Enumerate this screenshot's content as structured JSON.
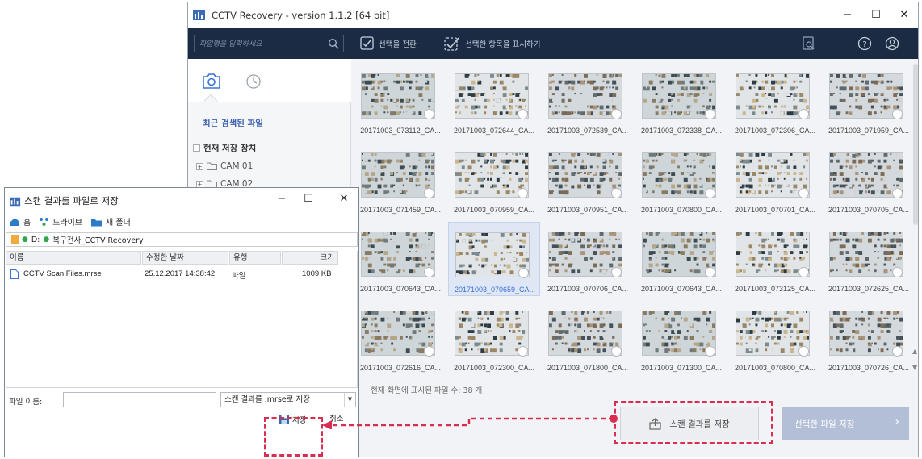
{
  "main_window": {
    "title": "CCTV Recovery - version 1.1.2 [64 bit]",
    "controls": {
      "minimize": "−",
      "maximize": "☐",
      "close": "✕"
    }
  },
  "toolbar": {
    "search_placeholder": "파일명을 입력하세요",
    "toggle_selection_label": "선택을 전환",
    "show_selected_label": "선택한 항목을 표시하기"
  },
  "sidebar": {
    "recent_label": "최근 검색된 파일",
    "current_device_label": "현재 저장 장치",
    "tree_items": [
      "CAM 01",
      "CAM 02"
    ]
  },
  "thumbnails": [
    "20171003_073112_CA...",
    "20171003_072644_CA...",
    "20171003_072539_CA...",
    "20171003_072338_CA...",
    "20171003_072306_CA...",
    "20171003_071959_CA...",
    "20171003_071459_CA...",
    "20171003_070959_CA...",
    "20171003_070951_CA...",
    "20171003_070800_CA...",
    "20171003_070701_CA...",
    "20171003_070705_CA...",
    "20171003_070643_CA...",
    "20171003_070659_CA...",
    "20171003_070706_CA...",
    "20171003_070643_CA...",
    "20171003_073125_CA...",
    "20171003_072625_CA...",
    "20171003_072616_CA...",
    "20171003_072300_CA...",
    "20171003_071800_CA...",
    "20171003_071300_CA...",
    "20171003_070800_CA...",
    "20171003_070726_CA..."
  ],
  "selected_thumbnail_label": "20171003_070659_CA...",
  "status": "현재 화면에 표시된 파일 수: 38 개",
  "bottom_buttons": {
    "save_scan": "스캔 결과를 저장",
    "save_selected": "선택한 파일 저장"
  },
  "dialog": {
    "title": "스캔 결과를 파일로 저장",
    "controls": {
      "minimize": "−",
      "maximize": "☐",
      "close": "✕"
    },
    "nav": {
      "home": "홈",
      "drive": "드라이브",
      "new_folder": "새 폴더"
    },
    "path": {
      "drive": "D:",
      "folder": "복구전사_CCTV Recovery"
    },
    "columns": {
      "name": "이름",
      "modified": "수정한 날짜",
      "type": "유형",
      "size": "크기"
    },
    "file": {
      "name": "CCTV Scan Files.mrse",
      "modified": "25.12.2017 14:38:42",
      "type": "파일",
      "size": "1009 KB"
    },
    "filename_label": "파일 이름:",
    "filetype_value": "스캔 결과를 .mrse로 저장",
    "save_label": "저장",
    "cancel_label": "취소"
  },
  "colors": {
    "accent": "#d92e4f",
    "toolbar_bg": "#1b2b44",
    "selected_text": "#3b72d8"
  }
}
